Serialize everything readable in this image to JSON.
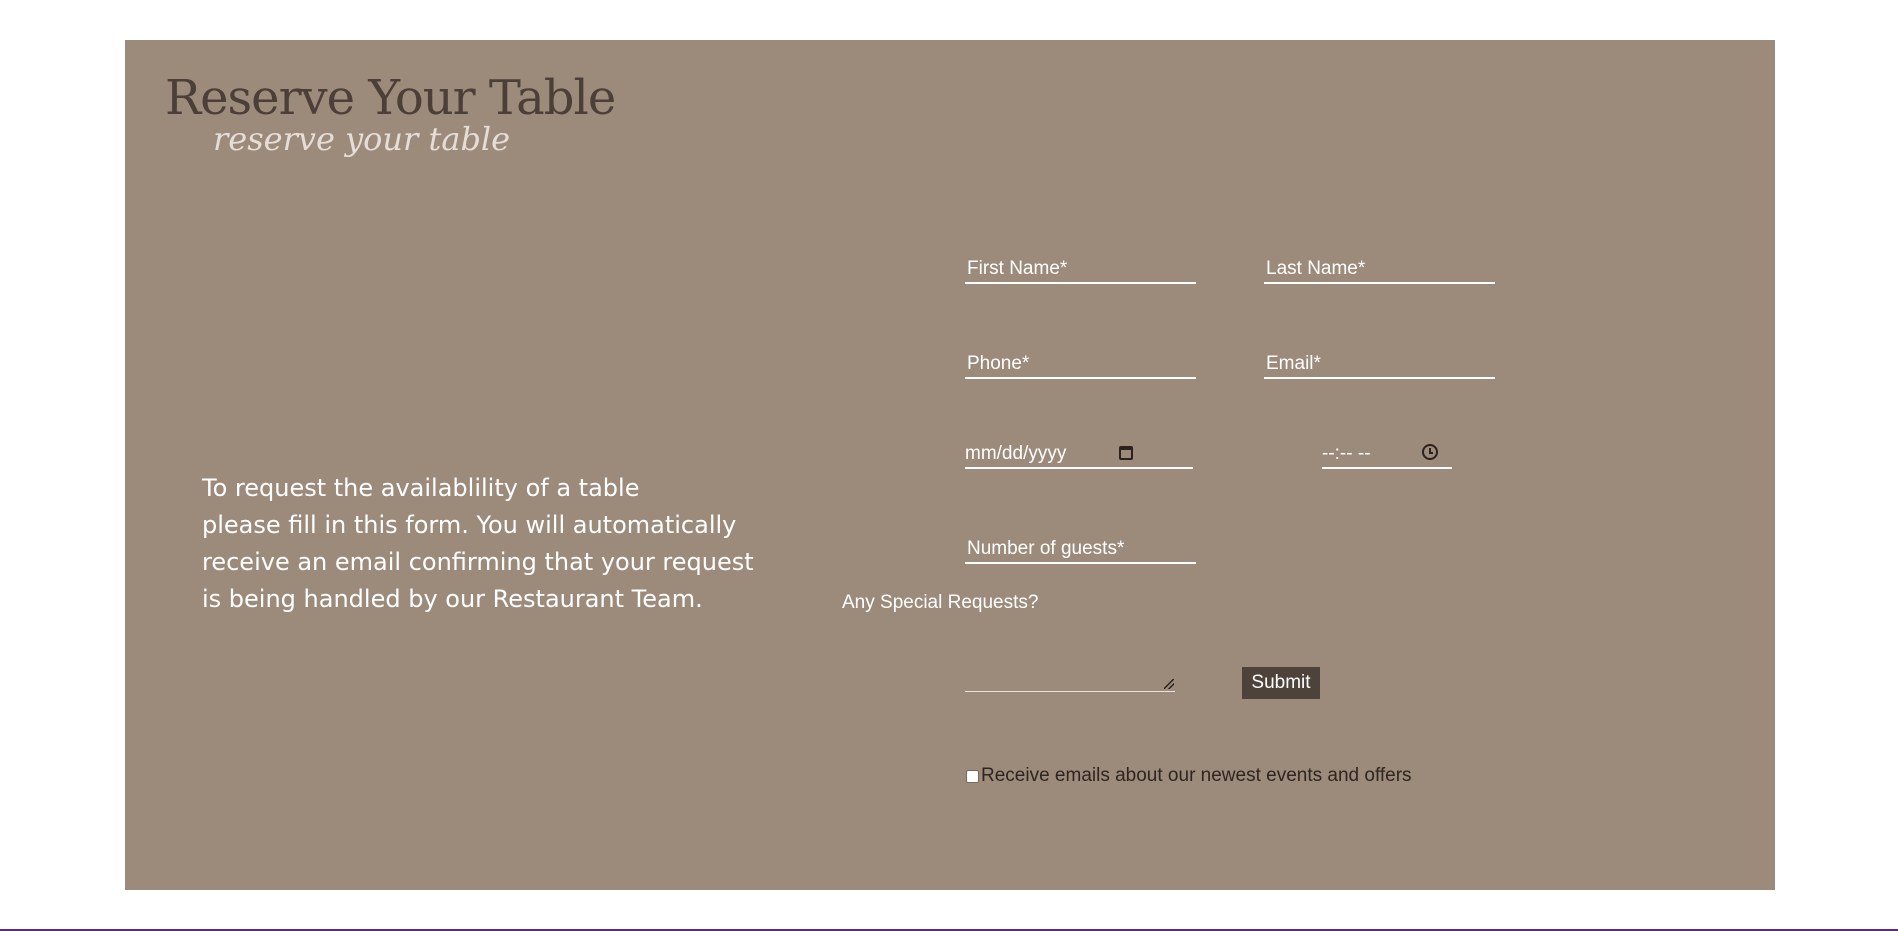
{
  "header": {
    "title": "Reserve Your Table",
    "script_title": "reserve your table"
  },
  "intro": {
    "text_lines": [
      "To request the availablility of a table",
      "please fill in this form. You will automatically",
      "receive an email confirming that your request",
      "is being handled by our Restaurant Team."
    ]
  },
  "form": {
    "first_name_placeholder": "First Name*",
    "last_name_placeholder": "Last Name*",
    "phone_placeholder": "Phone*",
    "email_placeholder": "Email*",
    "date_value": "mm/dd/yyyy",
    "time_value": "--:-- --",
    "guests_placeholder": "Number of guests*",
    "special_requests_label": "Any Special Requests?",
    "submit_label": "Submit",
    "optin_label": "Receive emails about our newest events and offers",
    "optin_checked": false
  },
  "icons": {
    "date": "calendar-icon",
    "time": "clock-icon"
  },
  "colors": {
    "panel_background": "#9c8b7b",
    "title_text": "#4b3f37",
    "submit_background": "#4e433b",
    "page_background": "#ffffff"
  }
}
